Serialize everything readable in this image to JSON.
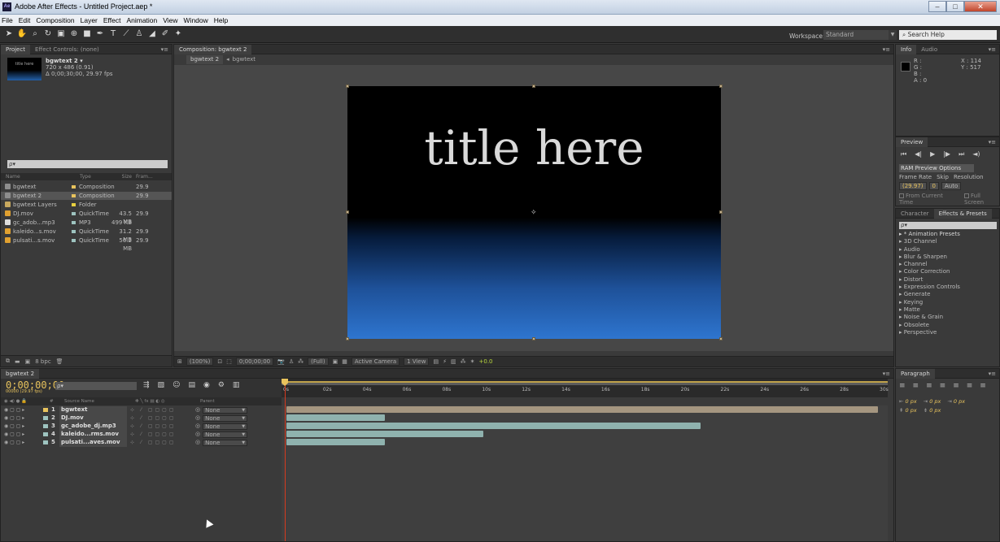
{
  "window": {
    "title": "Adobe After Effects - Untitled Project.aep *",
    "app_icon": "Ae"
  },
  "menu": [
    "File",
    "Edit",
    "Composition",
    "Layer",
    "Effect",
    "Animation",
    "View",
    "Window",
    "Help"
  ],
  "workspace": {
    "label": "Workspace:",
    "value": "Standard"
  },
  "help_search": {
    "placeholder": "Search Help"
  },
  "project": {
    "tabs": [
      "Project",
      "Effect Controls: (none)"
    ],
    "selected_item": {
      "name": "bgwtext 2 ▾",
      "dims": "720 x 486 (0.91)",
      "duration": "Δ 0;00;30;00, 29.97 fps",
      "thumb_text": "title here"
    },
    "search_placeholder": "ρ▾",
    "columns": [
      "Name",
      "Type",
      "Size",
      "Fram..."
    ],
    "items": [
      {
        "name": "bgwtext",
        "type": "Composition",
        "size": "",
        "fps": "29.9",
        "icon_color": "#8d8d8d",
        "label_color": "#e8c35d",
        "selected": false
      },
      {
        "name": "bgwtext 2",
        "type": "Composition",
        "size": "",
        "fps": "29.9",
        "icon_color": "#8d8d8d",
        "label_color": "#e8c35d",
        "selected": true
      },
      {
        "name": "bgwtext Layers",
        "type": "Folder",
        "size": "",
        "fps": "",
        "icon_color": "#c7a85e",
        "label_color": "#e8d040",
        "selected": false
      },
      {
        "name": "DJ.mov",
        "type": "QuickTime",
        "size": "43.5 MB",
        "fps": "29.9",
        "icon_color": "#e0a030",
        "label_color": "#9ec4c0",
        "selected": false
      },
      {
        "name": "gc_adob...mp3",
        "type": "MP3",
        "size": "499 KB",
        "fps": "",
        "icon_color": "#ddd",
        "label_color": "#9ec4c0",
        "selected": false
      },
      {
        "name": "kaleido...s.mov",
        "type": "QuickTime",
        "size": "31.2 MB",
        "fps": "29.9",
        "icon_color": "#e0a030",
        "label_color": "#9ec4c0",
        "selected": false
      },
      {
        "name": "pulsati...s.mov",
        "type": "QuickTime",
        "size": "56.2 MB",
        "fps": "29.9",
        "icon_color": "#e0a030",
        "label_color": "#9ec4c0",
        "selected": false
      }
    ],
    "footer_bpc": "8 bpc"
  },
  "composition": {
    "tab": "Composition: bgwtext 2",
    "breadcrumb": [
      "bgwtext 2",
      "bgwtext"
    ],
    "frame_title": "title here",
    "footer": {
      "zoom": "(100%)",
      "timecode": "0;00;00;00",
      "quality": "(Full)",
      "camera": "Active Camera",
      "views": "1 View",
      "exposure": "+0.0"
    }
  },
  "info": {
    "tabs": [
      "Info",
      "Audio"
    ],
    "r": "R :",
    "g": "G :",
    "b": "B :",
    "a": "A : 0",
    "x": "X : 114",
    "y": "Y : 517"
  },
  "preview": {
    "tab": "Preview",
    "ram_options": "RAM Preview Options",
    "labels": [
      "Frame Rate",
      "Skip",
      "Resolution"
    ],
    "frame_rate": "(29.97)",
    "skip": "0",
    "resolution": "Auto",
    "from_current": "From Current Time",
    "full_screen": "Full Screen"
  },
  "effects": {
    "tabs": [
      "Character",
      "Effects & Presets"
    ],
    "search_placeholder": "ρ▾",
    "items": [
      "▸ * Animation Presets",
      "▸ 3D Channel",
      "▸ Audio",
      "▸ Blur & Sharpen",
      "▸ Channel",
      "▸ Color Correction",
      "▸ Distort",
      "▸ Expression Controls",
      "▸ Generate",
      "▸ Keying",
      "▸ Matte",
      "▸ Noise & Grain",
      "▸ Obsolete",
      "▸ Perspective"
    ]
  },
  "timeline": {
    "tab": "bgwtext 2",
    "timecode": "0;00;00;00",
    "timecode_sub": "00000 (29.97 fps)",
    "search_placeholder": "ρ▾",
    "ruler_ticks": [
      "0s",
      "02s",
      "04s",
      "06s",
      "08s",
      "10s",
      "12s",
      "14s",
      "16s",
      "18s",
      "20s",
      "22s",
      "24s",
      "26s",
      "28s",
      "30s"
    ],
    "col_headers": {
      "num": "#",
      "source": "Source Name",
      "parent": "Parent"
    },
    "layers": [
      {
        "num": "1",
        "name": "bgwtext",
        "parent": "None",
        "label_color": "#e8c35d",
        "bar_color": "#a59680",
        "bar_end": 30
      },
      {
        "num": "2",
        "name": "DJ.mov",
        "parent": "None",
        "label_color": "#9ec4c0",
        "bar_color": "#8fb2ae",
        "bar_end": 5
      },
      {
        "num": "3",
        "name": "gc_adobe_dj.mp3",
        "parent": "None",
        "label_color": "#9ec4c0",
        "bar_color": "#8fb2ae",
        "bar_end": 21
      },
      {
        "num": "4",
        "name": "kaleido...rms.mov",
        "parent": "None",
        "label_color": "#9ec4c0",
        "bar_color": "#8fb2ae",
        "bar_end": 10
      },
      {
        "num": "5",
        "name": "pulsati...aves.mov",
        "parent": "None",
        "label_color": "#9ec4c0",
        "bar_color": "#8fb2ae",
        "bar_end": 5
      }
    ]
  },
  "paragraph": {
    "tab": "Paragraph",
    "rows": [
      [
        "0 px",
        "0 px",
        "0 px"
      ],
      [
        "0 px",
        "0 px"
      ]
    ]
  }
}
